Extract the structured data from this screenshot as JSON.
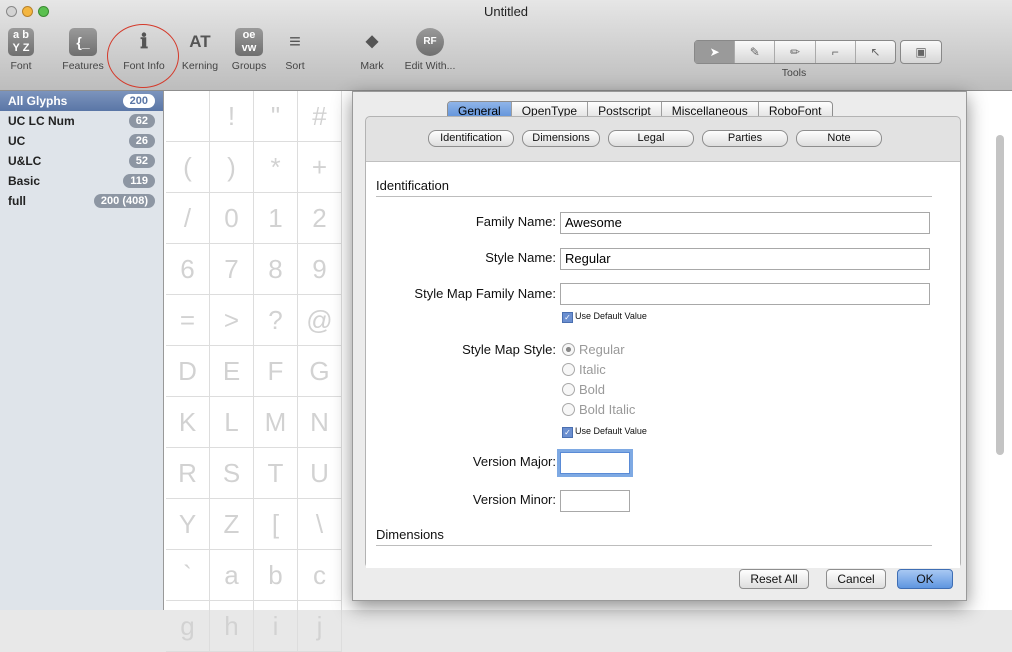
{
  "window": {
    "title": "Untitled"
  },
  "toolbar": {
    "items": [
      {
        "label": "Font",
        "icon": "font-icon",
        "glyph": "ab"
      },
      {
        "label": "Features",
        "icon": "features-icon",
        "glyph": "{"
      },
      {
        "label": "Font Info",
        "icon": "font-info-icon",
        "glyph": "i"
      },
      {
        "label": "Kerning",
        "icon": "kerning-icon",
        "glyph": "AT"
      },
      {
        "label": "Groups",
        "icon": "groups-icon",
        "glyph": "oe"
      },
      {
        "label": "Sort",
        "icon": "sort-icon",
        "glyph": "≡"
      },
      {
        "label": "Mark",
        "icon": "mark-icon",
        "glyph": "◆"
      },
      {
        "label": "Edit With...",
        "icon": "edit-with-icon",
        "glyph": "RF"
      }
    ],
    "tools_label": "Tools"
  },
  "sidebar": {
    "items": [
      {
        "label": "All Glyphs",
        "count": "200",
        "selected": true
      },
      {
        "label": "UC LC Num",
        "count": "62"
      },
      {
        "label": "UC",
        "count": "26"
      },
      {
        "label": "U&LC",
        "count": "52"
      },
      {
        "label": "Basic",
        "count": "119"
      },
      {
        "label": "full",
        "count": "200 (408)"
      }
    ]
  },
  "glyph_grid": {
    "glyphs": [
      "",
      "!",
      "\"",
      "#",
      "(",
      ")",
      "*",
      "+",
      "/",
      "0",
      "1",
      "2",
      "6",
      "7",
      "8",
      "9",
      "=",
      ">",
      "?",
      "@",
      "D",
      "E",
      "F",
      "G",
      "K",
      "L",
      "M",
      "N",
      "R",
      "S",
      "T",
      "U",
      "Y",
      "Z",
      "[",
      "\\",
      "`",
      "a",
      "b",
      "c",
      "g",
      "h",
      "i",
      "j"
    ]
  },
  "font_info": {
    "tabs": [
      "General",
      "OpenType",
      "Postscript",
      "Miscellaneous",
      "RoboFont"
    ],
    "active_tab": "General",
    "subtabs": [
      "Identification",
      "Dimensions",
      "Legal",
      "Parties",
      "Note"
    ],
    "section_identification": "Identification",
    "family_name_label": "Family Name:",
    "family_name_value": "Awesome",
    "style_name_label": "Style Name:",
    "style_name_value": "Regular",
    "style_map_family_label": "Style Map Family Name:",
    "style_map_family_value": "",
    "use_default_1": "Use Default Value",
    "style_map_style_label": "Style Map Style:",
    "style_options": [
      "Regular",
      "Italic",
      "Bold",
      "Bold Italic"
    ],
    "use_default_2": "Use Default Value",
    "version_major_label": "Version Major:",
    "version_minor_label": "Version Minor:",
    "section_dimensions": "Dimensions",
    "buttons": {
      "reset_all": "Reset All",
      "cancel": "Cancel",
      "ok": "OK"
    }
  }
}
